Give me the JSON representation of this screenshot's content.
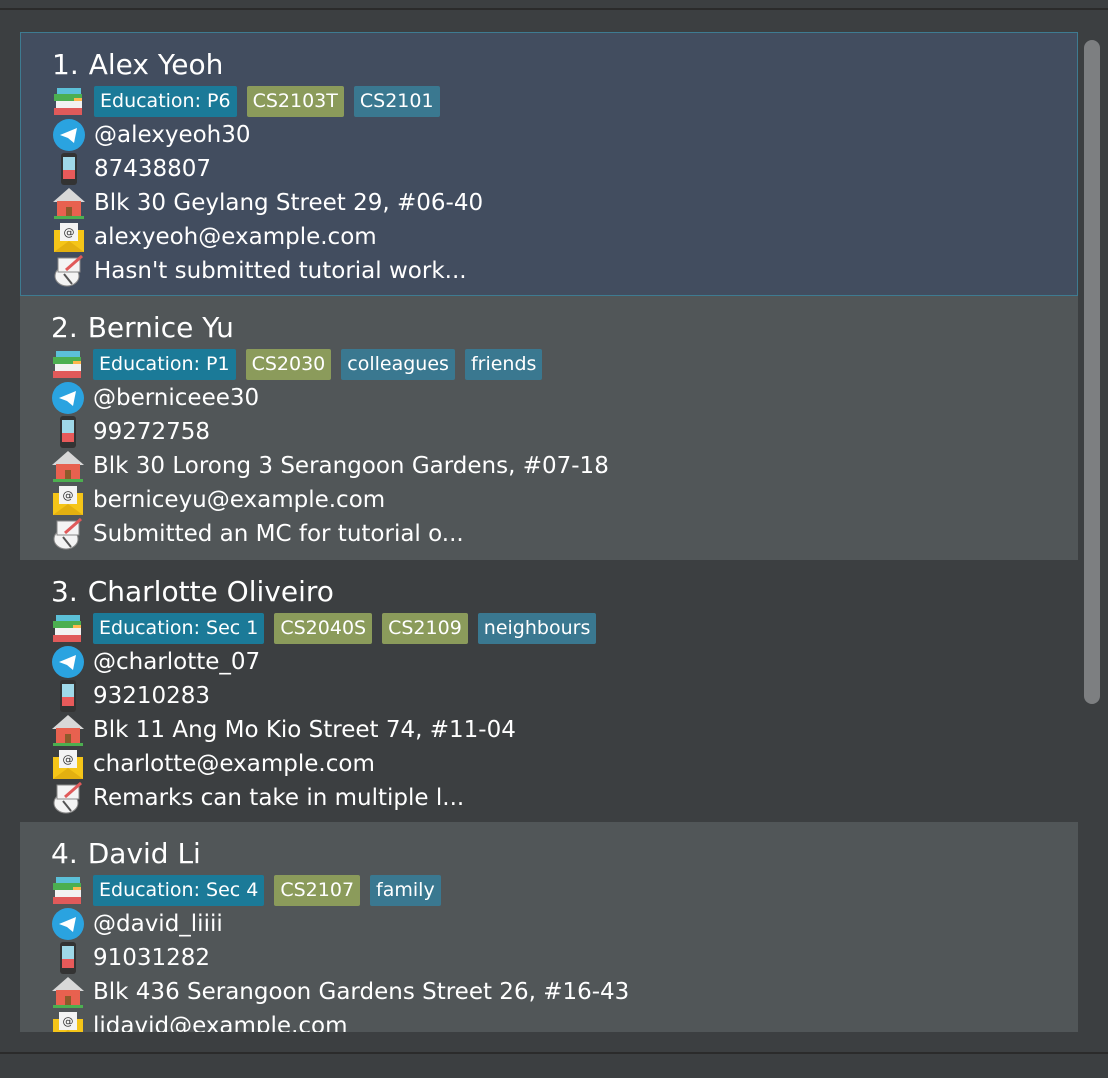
{
  "persons": [
    {
      "index": "1.",
      "name": "Alex Yeoh",
      "tags": [
        {
          "label": "Education: P6",
          "kind": "edu"
        },
        {
          "label": "CS2103T",
          "kind": "course"
        },
        {
          "label": "CS2101",
          "kind": "other"
        }
      ],
      "telegram": "@alexyeoh30",
      "phone": "87438807",
      "address": "Blk 30 Geylang Street 29, #06-40",
      "email": "alexyeoh@example.com",
      "remark": "Hasn't submitted tutorial work..."
    },
    {
      "index": "2.",
      "name": "Bernice Yu",
      "tags": [
        {
          "label": "Education: P1",
          "kind": "edu"
        },
        {
          "label": "CS2030",
          "kind": "course"
        },
        {
          "label": "colleagues",
          "kind": "other"
        },
        {
          "label": "friends",
          "kind": "other"
        }
      ],
      "telegram": "@berniceee30",
      "phone": "99272758",
      "address": "Blk 30 Lorong 3 Serangoon Gardens, #07-18",
      "email": "berniceyu@example.com",
      "remark": "Submitted an MC for tutorial o..."
    },
    {
      "index": "3.",
      "name": "Charlotte Oliveiro",
      "tags": [
        {
          "label": "Education: Sec 1",
          "kind": "edu"
        },
        {
          "label": "CS2040S",
          "kind": "course"
        },
        {
          "label": "CS2109",
          "kind": "course"
        },
        {
          "label": "neighbours",
          "kind": "other"
        }
      ],
      "telegram": "@charlotte_07",
      "phone": "93210283",
      "address": "Blk 11 Ang Mo Kio Street 74, #11-04",
      "email": "charlotte@example.com",
      "remark": "Remarks can take in multiple l..."
    },
    {
      "index": "4.",
      "name": "David Li",
      "tags": [
        {
          "label": "Education: Sec 4",
          "kind": "edu"
        },
        {
          "label": "CS2107",
          "kind": "course"
        },
        {
          "label": "family",
          "kind": "other"
        }
      ],
      "telegram": "@david_liiii",
      "phone": "91031282",
      "address": "Blk 436 Serangoon Gardens Street 26, #16-43",
      "email": "lidavid@example.com",
      "remark": ""
    }
  ],
  "icons": {
    "tags": "books-icon",
    "telegram": "telegram-icon",
    "phone": "phone-icon",
    "address": "house-icon",
    "email": "email-icon",
    "remark": "remark-icon"
  },
  "colors": {
    "edu_tag": "#1b7a98",
    "course_tag": "#8b9b5b",
    "other_tag": "#3a7890",
    "selected_card": "#424d5f"
  }
}
